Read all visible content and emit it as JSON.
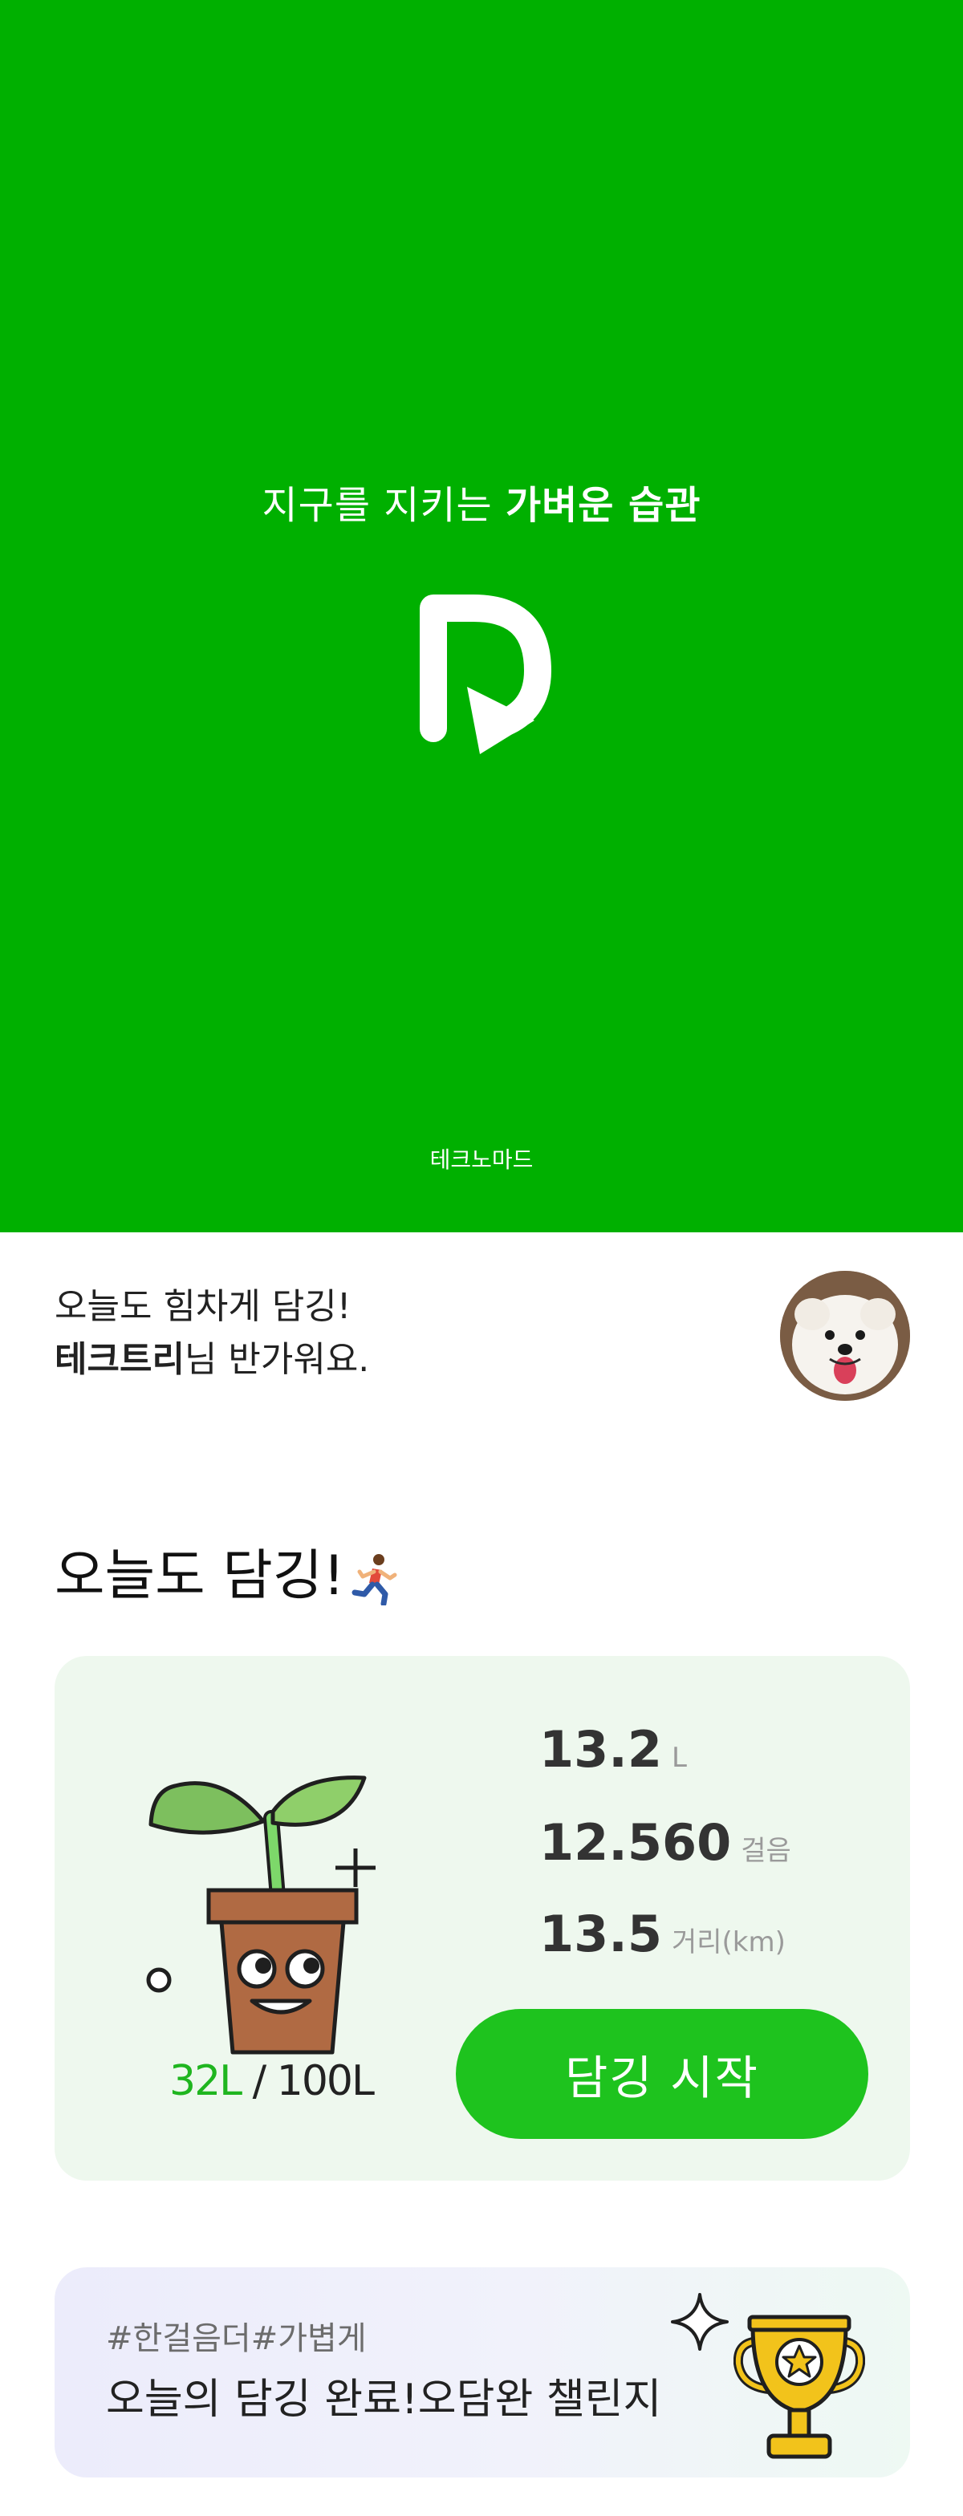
{
  "splash": {
    "tagline_regular": "지구를 지키는 ",
    "tagline_bold": "가벼운 습관",
    "company": "테크노마드",
    "background_color": "#00b000",
    "logo_icon": "plogging-logo-icon"
  },
  "greeting": {
    "line1": "오늘도 힘차게 담깅!",
    "name": "테크트리",
    "line2_suffix": "님 반가워요.",
    "avatar_icon": "dog-avatar"
  },
  "section": {
    "title": "오늘도 담깅!",
    "title_icon": "running-person-icon"
  },
  "stats": {
    "progress_current": "32L",
    "progress_separator": " / ",
    "progress_total": "100L",
    "rows": [
      {
        "value": "13.2",
        "unit": "L"
      },
      {
        "value": "12.560",
        "unit": "걸음"
      },
      {
        "value": "13.5",
        "unit": "거리(km)"
      }
    ],
    "start_button": "담깅 시작",
    "accent_color": "#1ec31e"
  },
  "challenge": {
    "tags": "#한걸음더#가볍게",
    "title": "오늘의 담깅 완료!오담완 챌린지",
    "icon": "trophy-icon"
  }
}
